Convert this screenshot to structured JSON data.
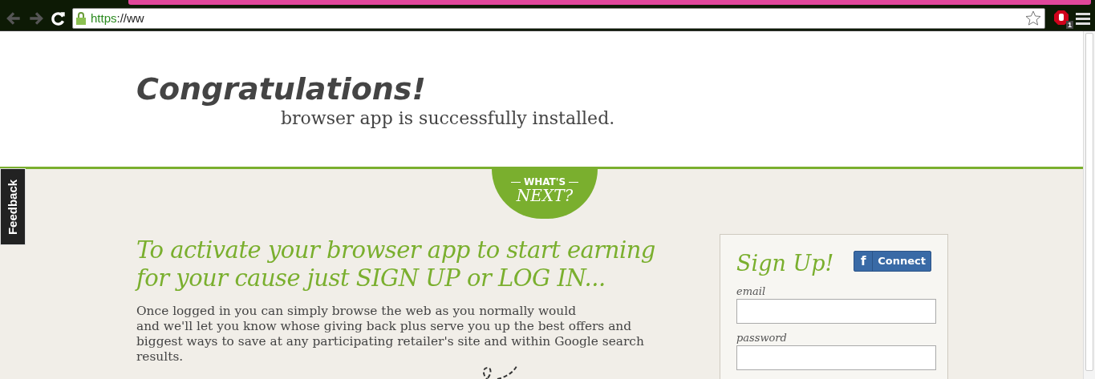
{
  "browser": {
    "url": "https://ww",
    "blocker_badge": "1"
  },
  "header": {
    "title": "Congratulations!",
    "subtitle": "browser app is successfully installed."
  },
  "whats_next": {
    "line1": "WHAT'S",
    "line2": "NEXT?"
  },
  "feedback_tab": "Feedback",
  "main": {
    "heading": "To activate your browser app to start earning\nfor your cause just SIGN UP or LOG IN...",
    "body": "Once logged in you can simply browse the web as you normally would\nand we'll let you know whose giving back plus serve you up the best offers and biggest ways to save at any participating retailer's site and within Google search results."
  },
  "signup": {
    "title": "Sign Up!",
    "facebook_button": "Connect",
    "facebook_glyph": "f",
    "fields": [
      {
        "label": "email"
      },
      {
        "label": "password"
      }
    ]
  }
}
